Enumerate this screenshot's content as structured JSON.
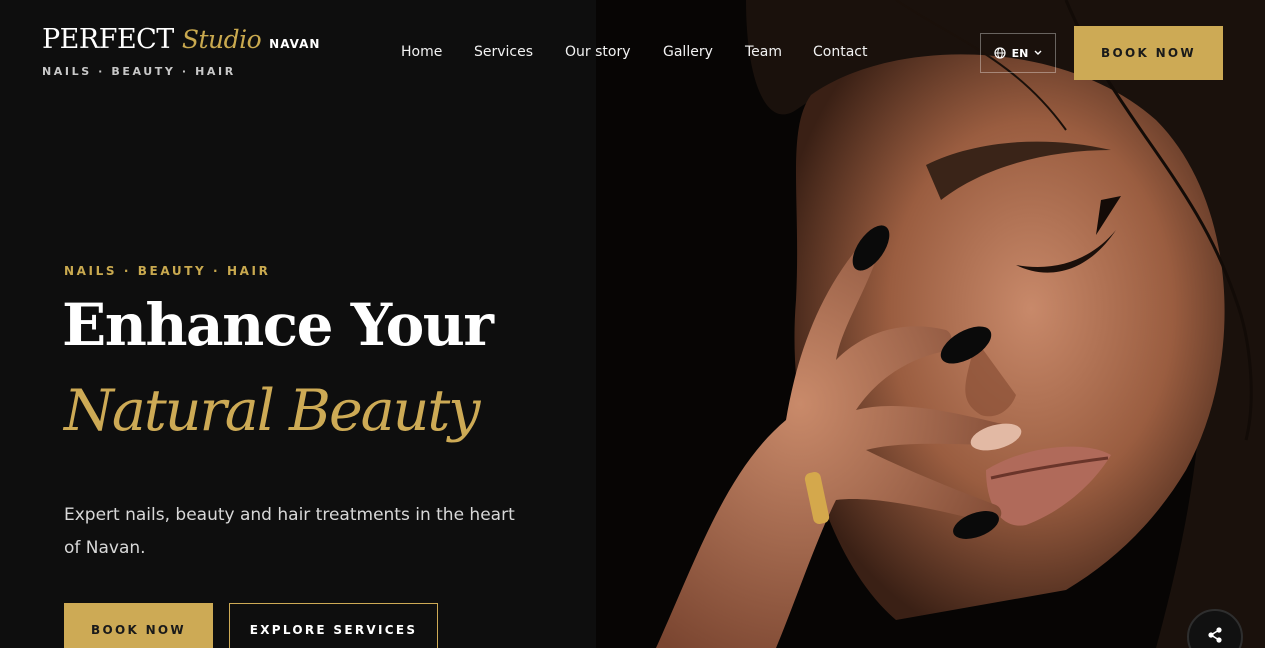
{
  "logo": {
    "perfect": "PERFECT",
    "studio": "Studio",
    "location": "NAVAN",
    "tagline": "NAILS · BEAUTY · HAIR"
  },
  "nav": {
    "items": [
      {
        "label": "Home"
      },
      {
        "label": "Services"
      },
      {
        "label": "Our story"
      },
      {
        "label": "Gallery"
      },
      {
        "label": "Team"
      },
      {
        "label": "Contact"
      }
    ]
  },
  "header": {
    "language": "EN",
    "book_label": "BOOK NOW"
  },
  "hero": {
    "eyebrow": "NAILS · BEAUTY · HAIR",
    "title_line1": "Enhance Your",
    "title_line2": "Natural Beauty",
    "description": "Expert nails, beauty and hair treatments in the heart of Navan.",
    "book_label": "BOOK NOW",
    "explore_label": "EXPLORE SERVICES"
  },
  "colors": {
    "accent": "#cdaa55",
    "background": "#0e0e0e"
  },
  "icons": {
    "language": "globe-icon",
    "dropdown": "chevron-down-icon",
    "share": "share-icon"
  }
}
